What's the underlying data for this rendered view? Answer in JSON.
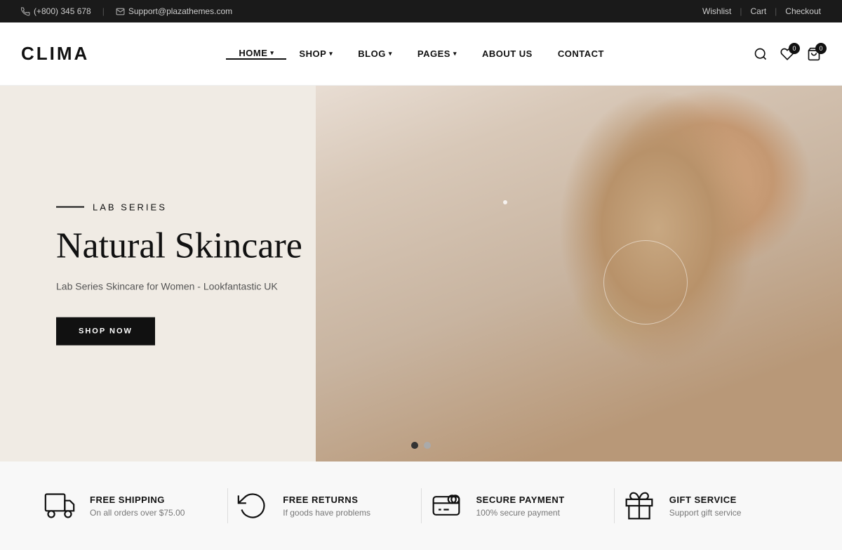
{
  "topbar": {
    "phone": "(+800) 345 678",
    "email": "Support@plazathemes.com",
    "wishlist": "Wishlist",
    "cart": "Cart",
    "checkout": "Checkout"
  },
  "header": {
    "logo": "CLIMA",
    "nav": [
      {
        "label": "HOME",
        "has_dropdown": true,
        "active": true
      },
      {
        "label": "SHOP",
        "has_dropdown": true,
        "active": false
      },
      {
        "label": "BLOG",
        "has_dropdown": true,
        "active": false
      },
      {
        "label": "PAGES",
        "has_dropdown": true,
        "active": false
      },
      {
        "label": "ABOUT US",
        "has_dropdown": false,
        "active": false
      },
      {
        "label": "CONTACT",
        "has_dropdown": false,
        "active": false
      }
    ],
    "wishlist_count": "0",
    "cart_count": "0"
  },
  "hero": {
    "label": "LAB SERIES",
    "title": "Natural Skincare",
    "subtitle": "Lab Series Skincare for Women - Lookfantastic UK",
    "cta": "SHOP NOW",
    "dots": [
      {
        "active": true
      },
      {
        "active": false
      }
    ]
  },
  "features": [
    {
      "id": "shipping",
      "icon": "truck-icon",
      "title": "FREE SHIPPING",
      "desc": "On all orders over $75.00"
    },
    {
      "id": "returns",
      "icon": "returns-icon",
      "title": "FREE RETURNS",
      "desc": "If goods have problems"
    },
    {
      "id": "payment",
      "icon": "payment-icon",
      "title": "SECURE PAYMENT",
      "desc": "100% secure payment"
    },
    {
      "id": "gift",
      "icon": "gift-icon",
      "title": "GIFT SERVICE",
      "desc": "Support gift service"
    }
  ]
}
